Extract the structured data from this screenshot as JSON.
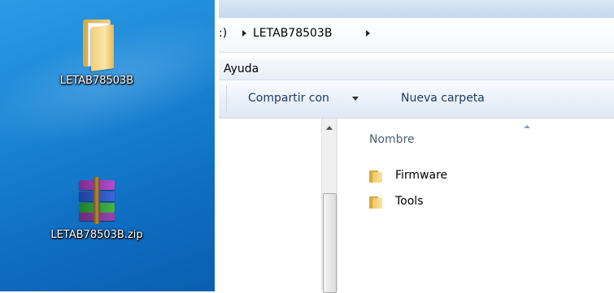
{
  "desktop": {
    "icons": [
      {
        "label": "LETAB78503B",
        "icon": "folder-icon"
      },
      {
        "label": "LETAB78503B.zip",
        "icon": "winrar-archive-icon"
      }
    ]
  },
  "explorer": {
    "address": {
      "drive_fragment": ":)",
      "folder": "LETAB78503B"
    },
    "menu": {
      "help": "Ayuda"
    },
    "toolbar": {
      "share_label": "Compartir con",
      "new_folder_label": "Nueva carpeta"
    },
    "list": {
      "column_name": "Nombre",
      "items": [
        {
          "name": "Firmware",
          "icon": "folder-icon"
        },
        {
          "name": "Tools",
          "icon": "folder-icon"
        }
      ]
    }
  },
  "colors": {
    "desktop_bg": "#1b86d6",
    "folder": "#f0c868"
  }
}
